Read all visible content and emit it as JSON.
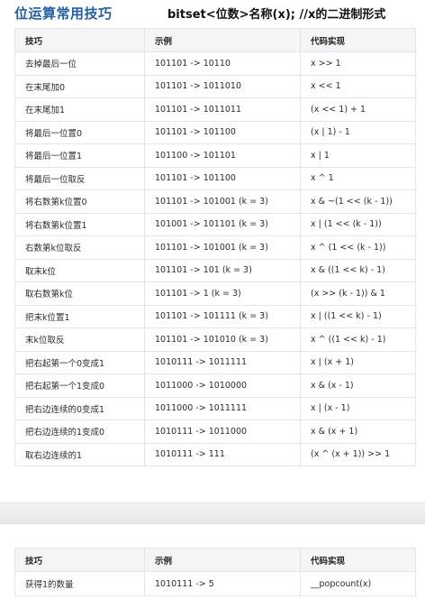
{
  "header": {
    "title": "位运算常用技巧",
    "subtitle": "bitset<位数>名称(x);  //x的二进制形式"
  },
  "table1": {
    "columns": [
      "技巧",
      "示例",
      "代码实现"
    ],
    "rows": [
      [
        "去掉最后一位",
        "101101 -> 10110",
        "x >> 1"
      ],
      [
        "在末尾加0",
        "101101 -> 1011010",
        "x << 1"
      ],
      [
        "在末尾加1",
        "101101 -> 1011011",
        "(x << 1) + 1"
      ],
      [
        "将最后一位置0",
        "101101 -> 101100",
        "(x | 1) - 1"
      ],
      [
        "将最后一位置1",
        "101100 -> 101101",
        "x | 1"
      ],
      [
        "将最后一位取反",
        "101101 -> 101100",
        "x ^ 1"
      ],
      [
        "将右数第k位置0",
        "101101 -> 101001 (k = 3)",
        "x & ~(1 << (k - 1))"
      ],
      [
        "将右数第k位置1",
        "101001 -> 101101 (k = 3)",
        "x | (1 << (k - 1))"
      ],
      [
        "右数第k位取反",
        "101101 -> 101001 (k = 3)",
        "x ^ (1 << (k - 1))"
      ],
      [
        "取末k位",
        "101101 -> 101 (k = 3)",
        "x & ((1 << k) - 1)"
      ],
      [
        "取右数第k位",
        "101101 -> 1 (k = 3)",
        "(x >> (k - 1)) & 1"
      ],
      [
        "把末k位置1",
        "101101 -> 101111 (k = 3)",
        "x | ((1 << k) - 1)"
      ],
      [
        "末k位取反",
        "101101 -> 101010 (k = 3)",
        "x ^ ((1 << k) - 1)"
      ],
      [
        "把右起第一个0变成1",
        "1010111 -> 1011111",
        "x | (x + 1)"
      ],
      [
        "把右起第一个1变成0",
        "1011000 -> 1010000",
        "x & (x - 1)"
      ],
      [
        "把右边连续的0变成1",
        "1011000 -> 1011111",
        "x | (x - 1)"
      ],
      [
        "把右边连续的1变成0",
        "1010111 -> 1011000",
        "x & (x + 1)"
      ],
      [
        "取右边连续的1",
        "1010111 -> 111",
        "(x ^ (x + 1)) >> 1"
      ]
    ]
  },
  "table2": {
    "columns": [
      "技巧",
      "示例",
      "代码实现"
    ],
    "rows": [
      [
        "获得1的数量",
        "1010111 -> 5",
        "__popcount(x)"
      ]
    ]
  }
}
